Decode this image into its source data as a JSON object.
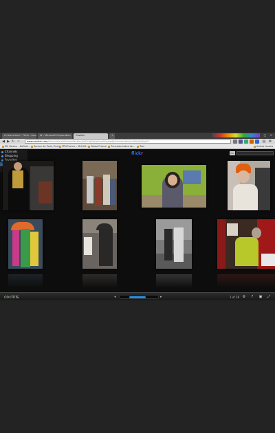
{
  "browser": {
    "tabs": [
      {
        "label": "A new a born ! Flickr - Lovel",
        "active": false
      },
      {
        "label": "W - Microsoft Corporation",
        "active": false
      },
      {
        "label": "Cooliris",
        "active": true
      },
      {
        "label": "+",
        "active": false
      }
    ],
    "address": {
      "host": "www.cooliris.com",
      "path": "/site/cooliris/#/rss/reflection/m/f/n/q/t/o/yt/cooliris/apd/pictures/d/o/s/n/d/i/s/b/f/o/p/1"
    },
    "bookmarks": [
      "ZN Voisins - Definit...",
      "Source de Paris, Envi...",
      "FPN France - McCaff...",
      "Yahoo France",
      "Principes Index de...",
      "Tool",
      "Autres favoris"
    ]
  },
  "app": {
    "brand_prefix": "flick",
    "brand_suffix": "r",
    "menu": [
      {
        "label": "Channels",
        "active": false
      },
      {
        "label": "Shopping",
        "active": false
      },
      {
        "label": "Favorites",
        "active": false
      },
      {
        "label": "My Cooliris",
        "active": true
      }
    ],
    "search_placeholder": "",
    "search_button": "flick"
  },
  "status": {
    "logo_prefix": "co",
    "logo_highlight": "o",
    "logo_suffix": "liris",
    "zoom": "1 of 18",
    "slider_level": 0.55
  },
  "colors": {
    "accent": "#1f8fe8",
    "brand_blue": "#2f6fe0",
    "brand_pink": "#e0338a",
    "logo_green": "#4bbf3a"
  },
  "icons": [
    "settings-icon",
    "help-icon",
    "fullscreen-icon",
    "expand-icon"
  ]
}
